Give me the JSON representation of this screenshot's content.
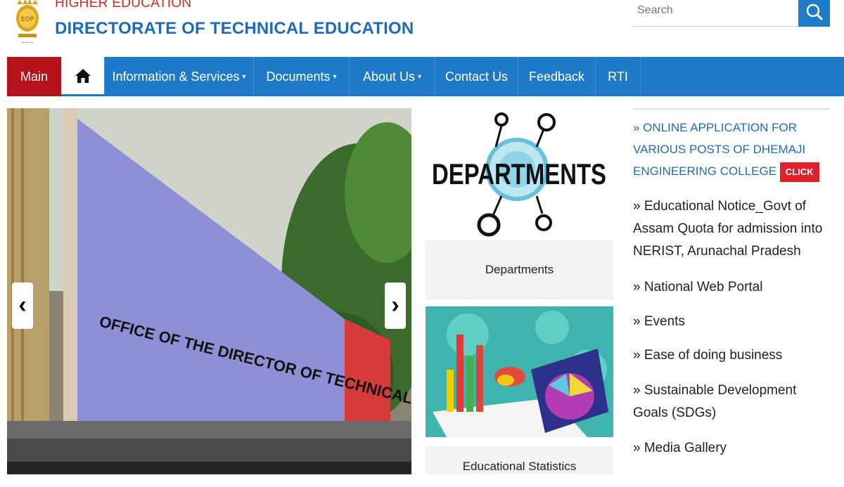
{
  "header": {
    "dept_label": "HIGHER EDUCATION",
    "org_name": "DIRECTORATE OF TECHNICAL EDUCATION",
    "search_placeholder": "Search"
  },
  "nav": {
    "items": [
      {
        "label": "Main"
      },
      {
        "label": "Information & Services",
        "caret": "▾"
      },
      {
        "label": "Documents",
        "caret": "▾"
      },
      {
        "label": "About Us",
        "caret": "▾"
      },
      {
        "label": "Contact Us"
      },
      {
        "label": "Feedback"
      },
      {
        "label": "RTI"
      }
    ]
  },
  "slider": {
    "sign_line1": "OFFICE OF THE DIRECTOR OF TECHNICAL EDUCATION ASSAM",
    "prev": "‹",
    "next": "›"
  },
  "cards": [
    {
      "label": "Departments",
      "image_text": "DEPARTMENTS"
    },
    {
      "label": "Educational Statistics"
    }
  ],
  "news": {
    "first": "» ONLINE APPLICATION FOR VARIOUS POSTS OF DHEMAJI ENGINEERING COLLEGE",
    "click_label": "CLICK",
    "items": [
      "» Educational Notice_Govt of Assam Quota for admission into NERIST, Arunachal Pradesh",
      "» National Web Portal",
      "» Events",
      "» Ease of doing business",
      "» Sustainable Development Goals (SDGs)",
      "» Media Gallery"
    ]
  },
  "colors": {
    "nav_blue": "#1e79c8",
    "main_red": "#b5121b",
    "title_blue": "#1e6bb8",
    "dept_red": "#cc2a1f",
    "click_red": "#e0202a"
  }
}
